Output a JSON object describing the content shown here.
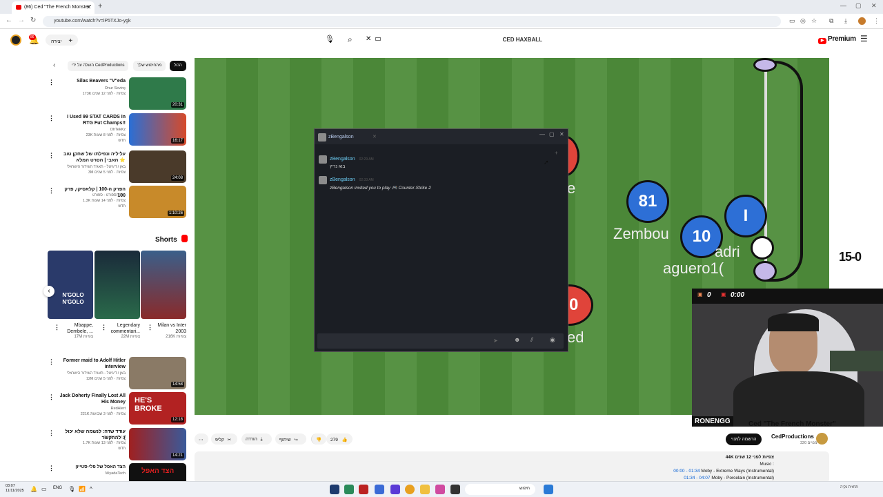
{
  "browser": {
    "tab_title": "(86) Ced \"The French Monster\"",
    "url": "youtube.com/watch?v=iP5TXJo-ygk"
  },
  "header": {
    "notif_count": "86",
    "create_label": "יצירה",
    "search_query": "CED HAXBALL",
    "premium_label": "Premium"
  },
  "chips": [
    "הכול",
    "מהחיפוש שלך",
    "הועלה על ידי CedProductions"
  ],
  "recommendations": [
    {
      "title": "Silas Beavers \"V\"eda",
      "channel": "Onur Sevinç",
      "meta": "173K צפיות · לפני 12 שנים",
      "duration": "20:31",
      "thumb": "#2f7a4a"
    },
    {
      "title": "I Used 99 STAT CARDS In RTG Fut Champs!!",
      "channel": "DhTekKz",
      "meta": "23K צפיות · לפני 8 שעות",
      "badge": "חדש",
      "duration": "16:17",
      "thumb": "#2a6fd6"
    },
    {
      "title": "עליליה ונפילתו של שחקן טוב האבי | הסרט המלא ⭐",
      "channel": "באן / דיגיטל - תאגיד השידור הישראלי",
      "meta": "3M צפיות · לפני 5 שנים",
      "duration": "24:08",
      "thumb": "#4a3a2a"
    },
    {
      "title": "הפרק ה-100 | קלאסיקו, פרק 100",
      "channel": "בית הספורט - ספורט",
      "meta": "1.3K צפיות · לפני 14 שעות",
      "badge": "חדש",
      "duration": "1:10:26",
      "thumb": "#c88a2a"
    },
    {
      "title": "Former maid to Adolf Hitler interview",
      "channel": "באן / דיגיטל - תאגיד השידור הישראלי",
      "meta": "12M צפיות · לפני 5 שנים",
      "duration": "14:58",
      "thumb": "#8a7a66"
    },
    {
      "title": "Jack Doherty Finally Lost All His Money",
      "channel": "RedAlert",
      "meta": "221K צפיות · לפני 3 שבועות",
      "duration": "12:18",
      "thumb": "#b22222"
    },
    {
      "title": "עודד שדה: לנשמה שלא יכול להתקשר :(",
      "channel": "CLIPS S.V.Q",
      "meta": "1.7K צפיות · לפני 13 שעות",
      "badge": "חדש",
      "duration": "14:21",
      "thumb": "#3a5a9a"
    },
    {
      "title": "הצד האפל של פלי-סטייזן",
      "channel": "MiyadaTech",
      "meta": "",
      "duration": "",
      "thumb": "#111111"
    }
  ],
  "shorts": {
    "title": "Shorts",
    "items": [
      {
        "title": "Milan vs Inter 2003",
        "views": "216K צפיות",
        "color": "#3a5f8a"
      },
      {
        "title": "Legendary commentari...",
        "views": "22M צפיות",
        "color": "#1a4a2a"
      },
      {
        "title": "Mbappe, Dembele, ...",
        "views": "17M צפיות",
        "color": "#2a3a6a",
        "overlay": "N'GOLO N'GOLO"
      }
    ]
  },
  "player": {
    "overlay_score": "15-0",
    "balls": [
      "81",
      "10",
      "20",
      "I"
    ],
    "names": [
      "Zembou",
      "adri",
      "aguero1(",
      "e",
      "ed"
    ]
  },
  "chat": {
    "window_title": "zBengalson",
    "messages": [
      {
        "name": "zBengalson",
        "time": "02:29 AM",
        "text": "בוא נריץ"
      },
      {
        "name": "zBengalson",
        "time": "02:33 AM",
        "text": "zBengalson invited you to play 🎮 Counter-Strike 2"
      }
    ]
  },
  "stream": {
    "label": "RONENGG",
    "hud_left": "0",
    "hud_timer": "0:00"
  },
  "video": {
    "title": "Ced \"The French Monster\"",
    "channel": "CedProductions",
    "subs": "320 מנויים",
    "subscribe": "הרשמה למנוי",
    "likes": "279",
    "share": "שיתוף",
    "download": "הורדה",
    "clip": "קליפ",
    "desc_views": "44K צפיות  לפני 12 שנים",
    "desc_music": "Music :",
    "desc_lines": [
      {
        "ts": "00:00 - 01:34",
        "text": " Moby - Extreme Ways (Instrumental)"
      },
      {
        "ts": "01:34 - 04:07",
        "text": " Moby - Porcelain (Instrumental)"
      }
    ]
  },
  "taskbar": {
    "time": "03:07",
    "date": "11/11/2025",
    "lang": "ENG",
    "search": "חיפוש",
    "weather": "תחזית נקיה"
  }
}
